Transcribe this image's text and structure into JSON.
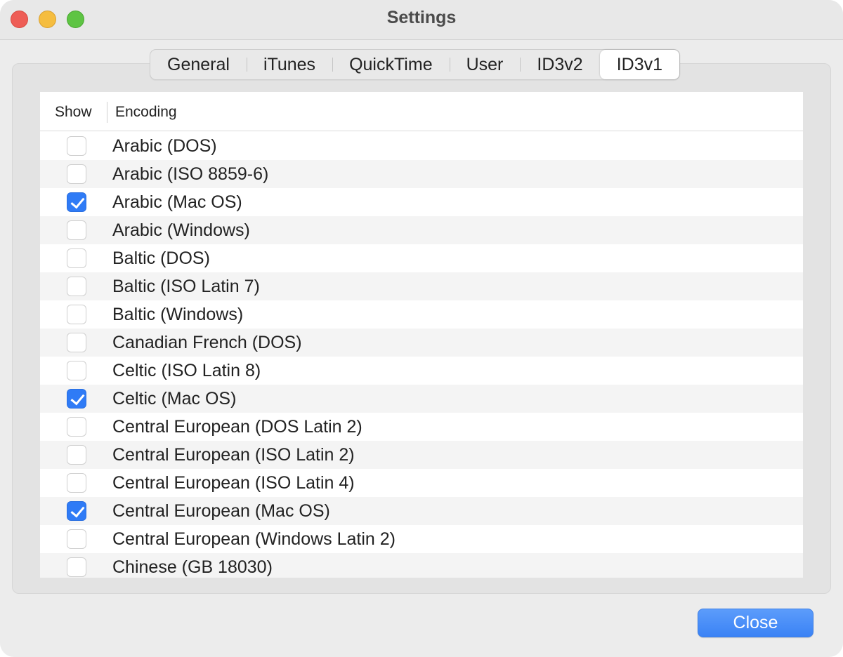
{
  "window": {
    "title": "Settings"
  },
  "tabs": [
    {
      "label": "General",
      "active": false
    },
    {
      "label": "iTunes",
      "active": false
    },
    {
      "label": "QuickTime",
      "active": false
    },
    {
      "label": "User",
      "active": false
    },
    {
      "label": "ID3v2",
      "active": false
    },
    {
      "label": "ID3v1",
      "active": true
    }
  ],
  "table": {
    "columns": [
      "Show",
      "Encoding"
    ],
    "rows": [
      {
        "label": "Arabic (DOS)",
        "checked": false
      },
      {
        "label": "Arabic (ISO 8859-6)",
        "checked": false
      },
      {
        "label": "Arabic (Mac OS)",
        "checked": true
      },
      {
        "label": "Arabic (Windows)",
        "checked": false
      },
      {
        "label": "Baltic (DOS)",
        "checked": false
      },
      {
        "label": "Baltic (ISO Latin 7)",
        "checked": false
      },
      {
        "label": "Baltic (Windows)",
        "checked": false
      },
      {
        "label": "Canadian French (DOS)",
        "checked": false
      },
      {
        "label": "Celtic (ISO Latin 8)",
        "checked": false
      },
      {
        "label": "Celtic (Mac OS)",
        "checked": true
      },
      {
        "label": "Central European (DOS Latin 2)",
        "checked": false
      },
      {
        "label": "Central European (ISO Latin 2)",
        "checked": false
      },
      {
        "label": "Central European (ISO Latin 4)",
        "checked": false
      },
      {
        "label": "Central European (Mac OS)",
        "checked": true
      },
      {
        "label": "Central European (Windows Latin 2)",
        "checked": false
      },
      {
        "label": "Chinese (GB 18030)",
        "checked": false
      }
    ]
  },
  "footer": {
    "close_label": "Close"
  },
  "colors": {
    "accent": "#2f7bf6"
  }
}
